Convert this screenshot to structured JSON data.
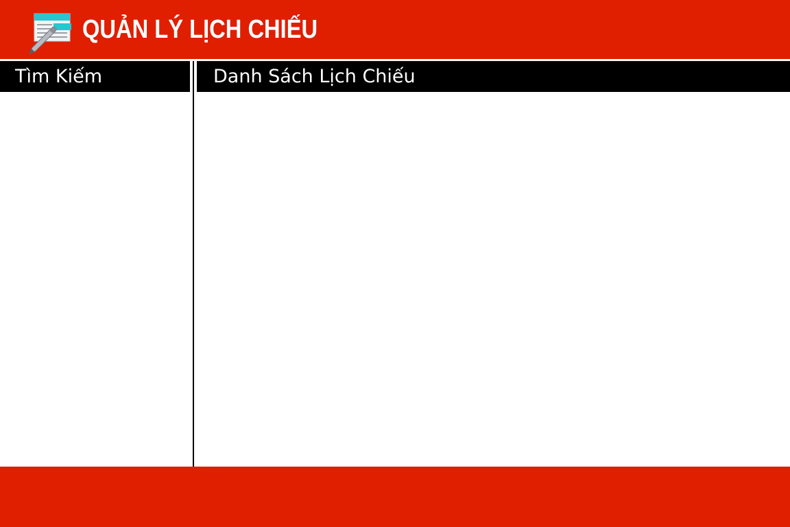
{
  "app": {
    "title": "QUẢN LÝ LỊCH CHIẾU",
    "icon": "schedule-edit-icon"
  },
  "left_panel": {
    "title": "Tìm Kiếm"
  },
  "main_panel": {
    "title": "Danh Sách Lịch Chiếu"
  },
  "colors": {
    "header_bg": "#e01e00",
    "footer_bg": "#e01e00",
    "panel_header_bg": "#000000",
    "panel_header_text": "#ffffff"
  }
}
